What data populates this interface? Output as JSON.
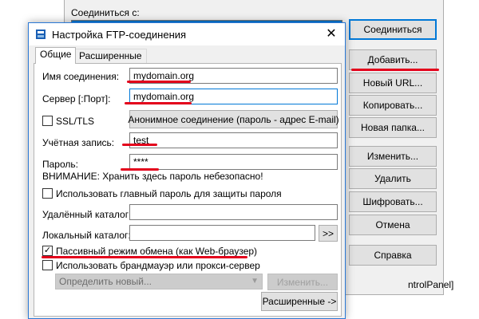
{
  "background_window": {
    "connect_to_label": "Соединиться с:",
    "buttons": {
      "connect": "Соединиться",
      "add": "Добавить...",
      "new_url": "Новый URL...",
      "copy": "Копировать...",
      "new_folder": "Новая папка...",
      "edit": "Изменить...",
      "delete": "Удалить",
      "encrypt": "Шифровать...",
      "cancel": "Отмена",
      "help": "Справка"
    },
    "overflow_text": "ntrolPanel]"
  },
  "dialog": {
    "title": "Настройка FTP-соединения",
    "close_glyph": "✕",
    "tabs": [
      "Общие",
      "Расширенные"
    ],
    "fields": {
      "connection_name": {
        "label": "Имя соединения:",
        "value": "mydomain.org"
      },
      "server": {
        "label": "Сервер [:Порт]:",
        "value": "mydomain.org"
      },
      "ssl_label": "SSL/TLS",
      "anonymous_button": "Анонимное соединение (пароль - адрес E-mail)",
      "account": {
        "label": "Учётная запись:",
        "value": "test"
      },
      "password": {
        "label": "Пароль:",
        "value": "****"
      },
      "warning": "ВНИМАНИЕ: Хранить здесь пароль небезопасно!",
      "master_password_label": "Использовать главный пароль для защиты пароля",
      "remote_dir_label": "Удалённый каталог:",
      "remote_dir_value": "",
      "local_dir_label": "Локальный каталог:",
      "local_dir_value": "",
      "browse_button": ">>",
      "passive_mode_label": "Пассивный режим обмена (как Web-браузер)",
      "passive_mode_checked": true,
      "passive_check_glyph": "✓",
      "firewall_label": "Использовать брандмауэр или прокси-сервер",
      "firewall_combo_value": "Определить новый...",
      "firewall_edit_button": "Изменить...",
      "advanced_button": "Расширенные ->"
    }
  },
  "colors": {
    "annotation": "#e3001b",
    "focus_border": "#0078d7",
    "dialog_bg": "#f0f0f0"
  }
}
